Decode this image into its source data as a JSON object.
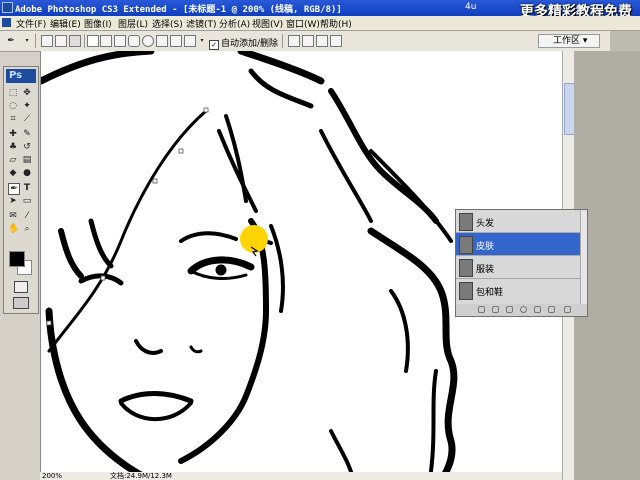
{
  "window": {
    "title": "Adobe Photoshop CS3 Extended - [未标题-1 @ 200% (线稿, RGB/8)]",
    "watermark": "更多精彩教程免费",
    "url_fragment": "4u"
  },
  "menu": {
    "items": [
      "文件(F)",
      "编辑(E)",
      "图像(I)",
      "图层(L)",
      "选择(S)",
      "滤镜(T)",
      "分析(A)",
      "视图(V)",
      "窗口(W)",
      "帮助(H)"
    ]
  },
  "options_bar": {
    "auto_add_delete_label": "自动添加/删除",
    "auto_add_delete_checked": true,
    "workspace_label": "工作区"
  },
  "toolbox": {
    "logo": "Ps"
  },
  "layers": {
    "items": [
      {
        "name": "头发",
        "active": false
      },
      {
        "name": "皮肤",
        "active": true
      },
      {
        "name": "服装",
        "active": false
      },
      {
        "name": "包和鞋",
        "active": false
      }
    ]
  },
  "status": {
    "zoom": "200%",
    "doc_info": "文档:24.9M/12.3M"
  },
  "colors": {
    "title_bar": "#0f3fbf",
    "active_layer": "#3366cc",
    "foreground": "#000000",
    "background": "#ffffff",
    "cursor_highlight": "#ffd400"
  }
}
